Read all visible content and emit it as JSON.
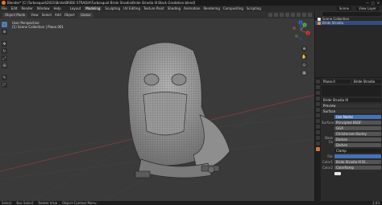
{
  "titlebar": {
    "title": "Blender* [C:\\Turbosquid\\2021\\Bride\\BRIDE STRADIA\\Turbosquid Bride Stradia\\Bride Stradia III Black Gradation.blend]",
    "minimize": "—",
    "maximize": "□",
    "close": "✕"
  },
  "menubar": {
    "menus": [
      "File",
      "Edit",
      "Render",
      "Window",
      "Help"
    ],
    "workspaces": [
      "Layout",
      "Modeling",
      "Sculpting",
      "UV Editing",
      "Texture Paint",
      "Shading",
      "Animation",
      "Rendering",
      "Compositing",
      "Scripting"
    ],
    "active_workspace_index": 1,
    "scene_label": "Scene",
    "view_layer_label": "View Layer"
  },
  "viewport_header": {
    "mode": "Object Mode",
    "view": "View",
    "select": "Select",
    "add": "Add",
    "object": "Object",
    "orientation": "Global"
  },
  "viewport": {
    "info_line1": "User Perspective",
    "info_line2": "(1) Scene Collection | Plane.001"
  },
  "gizmo": {
    "x": "X",
    "y": "Y",
    "z": "Z"
  },
  "outliner": {
    "rows": [
      {
        "label": "Scene Collection",
        "selected": false,
        "icon": "collection"
      },
      {
        "label": "Bride Stradia",
        "selected": true,
        "icon": "object"
      }
    ]
  },
  "properties": {
    "object_name": "Plane.0",
    "material_slot": "Bride Stradia",
    "material_name": "Bride Stradia III",
    "preview_label": "Preview",
    "surface_label": "Surface",
    "use_nodes": "Use Nodes",
    "rows": [
      {
        "label": "Surface",
        "value": "Principled BSDF"
      },
      {
        "label": "",
        "value": "GGX"
      },
      {
        "label": "",
        "value": "Christensen-Burley"
      },
      {
        "label": "Base Co",
        "value": "Darken"
      },
      {
        "label": "",
        "value": "Darken"
      },
      {
        "label": "",
        "value": "Clamp"
      },
      {
        "label": "Fac",
        "value": ""
      },
      {
        "label": "Color1",
        "value": "Bride Stradia III Bl..."
      },
      {
        "label": "Color2",
        "value": "ColorRamp"
      }
    ]
  },
  "statusbar": {
    "items": [
      "Select",
      "Box Select",
      "Rotate View",
      "Object Context Menu"
    ],
    "version": "2.93"
  }
}
